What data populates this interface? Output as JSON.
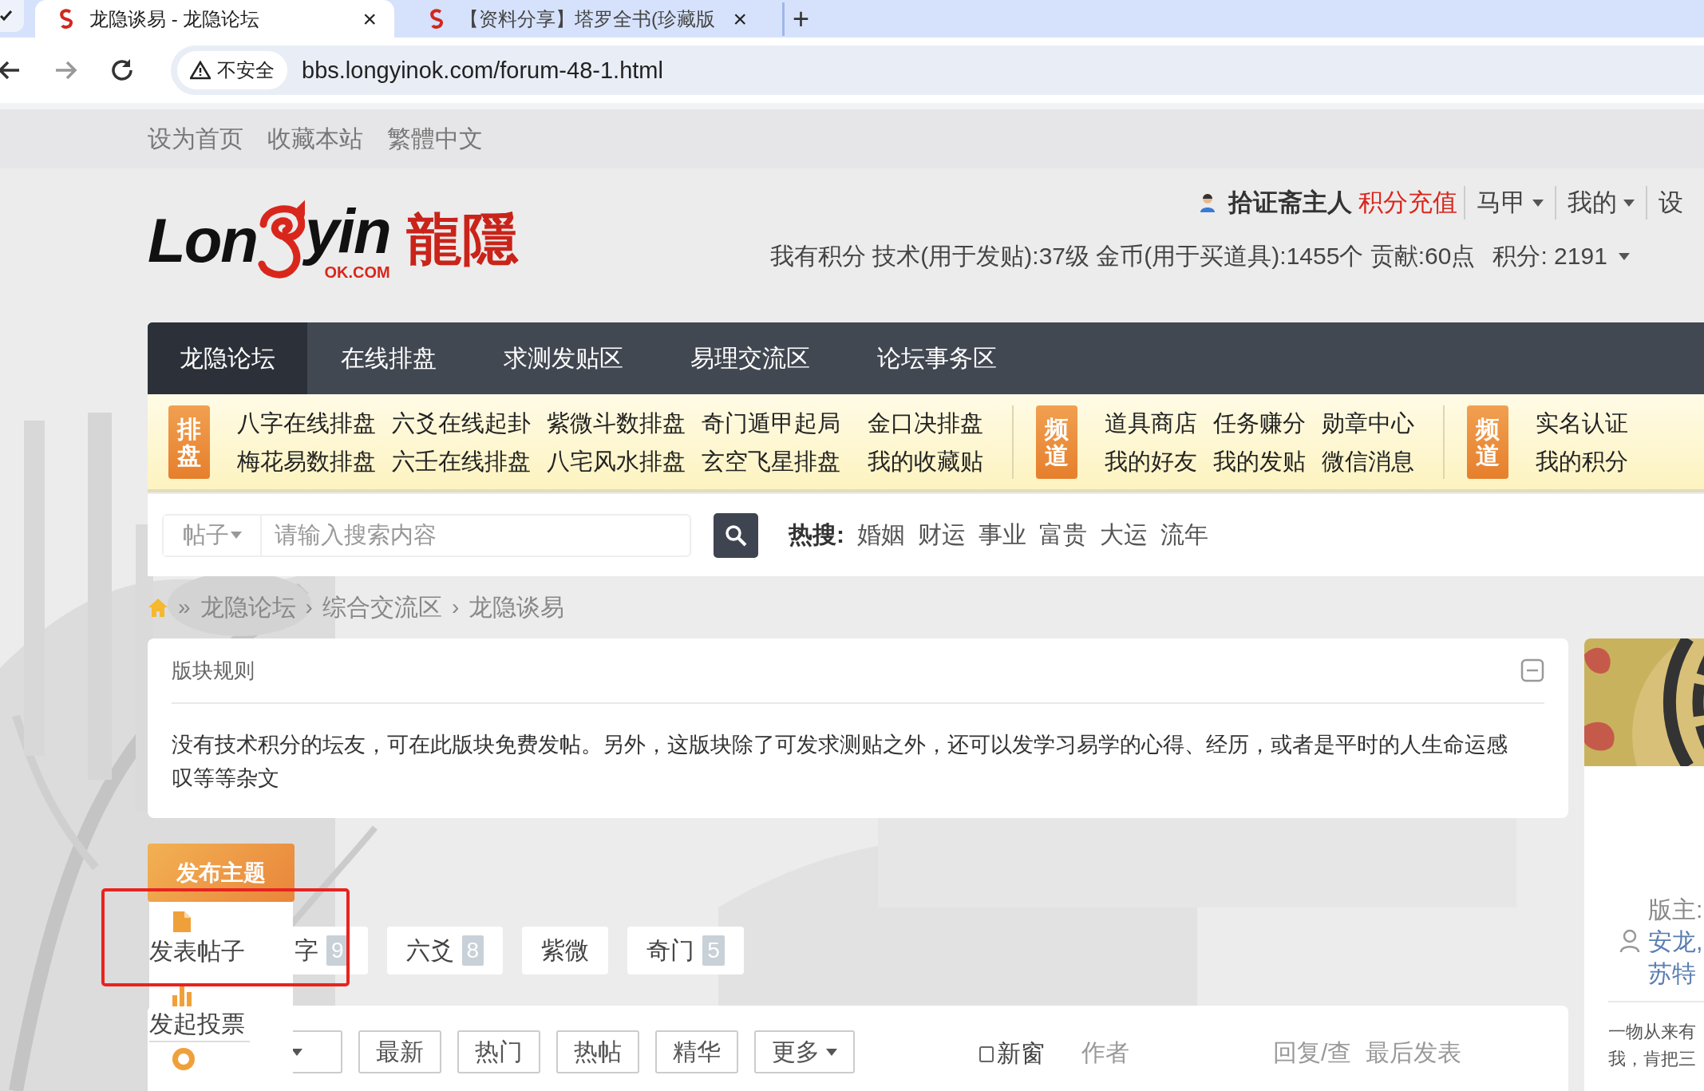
{
  "browser": {
    "tabs": [
      {
        "title": "龙隐谈易 - 龙隐论坛",
        "close": "×",
        "selected": true
      },
      {
        "title": "【资料分享】塔罗全书(珍藏版",
        "close": "×",
        "selected": false
      }
    ],
    "new_tab": "+",
    "security": "不安全",
    "url": "bbs.longyinok.com/forum-48-1.html"
  },
  "top_links": [
    "设为首页",
    "收藏本站",
    "繁體中文"
  ],
  "logo": {
    "left": "Lon",
    "right": "yin",
    "domain": "OK.COM",
    "chinese": "龍隱"
  },
  "user": {
    "name": "拾证斋主人",
    "recharge": "积分充值",
    "menus": [
      {
        "label": "马甲",
        "caret": true
      },
      {
        "label": "我的",
        "caret": true
      },
      {
        "label": "设",
        "caret": false
      }
    ],
    "stats": "我有积分 技术(用于发贴):37级 金币(用于买道具):1455个 贡献:60点",
    "credits": "积分: 2191"
  },
  "nav": [
    {
      "label": "龙隐论坛",
      "selected": true
    },
    {
      "label": "在线排盘",
      "selected": false
    },
    {
      "label": "求测发贴区",
      "selected": false
    },
    {
      "label": "易理交流区",
      "selected": false
    },
    {
      "label": "论坛事务区",
      "selected": false
    }
  ],
  "quick_groups": [
    {
      "badge": "排盘",
      "columns": [
        [
          "八字在线排盘",
          "梅花易数排盘"
        ],
        [
          "六爻在线起卦",
          "六壬在线排盘"
        ],
        [
          "紫微斗数排盘",
          "八宅风水排盘"
        ],
        [
          "奇门遁甲起局",
          "玄空飞星排盘"
        ],
        [
          "金口决排盘",
          "我的收藏贴"
        ]
      ]
    },
    {
      "badge": "频道",
      "columns": [
        [
          "道具商店",
          "我的好友"
        ],
        [
          "任务赚分",
          "我的发贴"
        ],
        [
          "勋章中心",
          "微信消息"
        ]
      ]
    },
    {
      "badge": "频道",
      "columns": [
        [
          "实名认证",
          "我的积分"
        ]
      ]
    }
  ],
  "search": {
    "type": "帖子",
    "placeholder": "请输入搜索内容",
    "hot_label": "热搜:",
    "hot": [
      "婚姻",
      "财运",
      "事业",
      "富贵",
      "大运",
      "流年"
    ]
  },
  "breadcrumb": [
    {
      "sep": "»",
      "label": "龙隐论坛"
    },
    {
      "sep": "›",
      "label": "综合交流区"
    },
    {
      "sep": "›",
      "label": "龙隐谈易"
    }
  ],
  "rules": {
    "title": "版块规则",
    "text": "没有技术积分的坛友，可在此版块免费发帖。另外，这版块除了可发求测贴之外，还可以发学习易学的心得、经历，或者是平时的人生命运感叹等等杂文"
  },
  "post_button": {
    "label": "发布主题",
    "menu": [
      {
        "kind": "post",
        "label": "发表帖子"
      },
      {
        "kind": "poll",
        "label": "发起投票"
      },
      {
        "kind": "reward"
      }
    ]
  },
  "annotation": {
    "kind": "rectangle"
  },
  "tags": [
    {
      "label": "字",
      "count": "9"
    },
    {
      "label": "六爻",
      "count": "8"
    },
    {
      "label": "紫微"
    },
    {
      "label": "奇门",
      "count": "5"
    }
  ],
  "filters": {
    "buttons": [
      {
        "caret": true
      },
      {
        "label": "最新",
        "caret": false
      },
      {
        "label": "热门",
        "caret": false
      },
      {
        "label": "热帖",
        "caret": false
      },
      {
        "label": "精华",
        "caret": false
      },
      {
        "label": "更多",
        "caret": true
      }
    ],
    "new_window": {
      "label": "新窗",
      "checked": false
    },
    "columns": [
      "作者",
      "回复/查",
      "最后发表"
    ]
  },
  "sidebar": {
    "picture": {
      "kind": "picture"
    },
    "moderators_label": "版主:",
    "moderators": [
      "安龙,",
      "苏特"
    ],
    "quote": [
      "一物从来有",
      "我，肯把三"
    ]
  }
}
